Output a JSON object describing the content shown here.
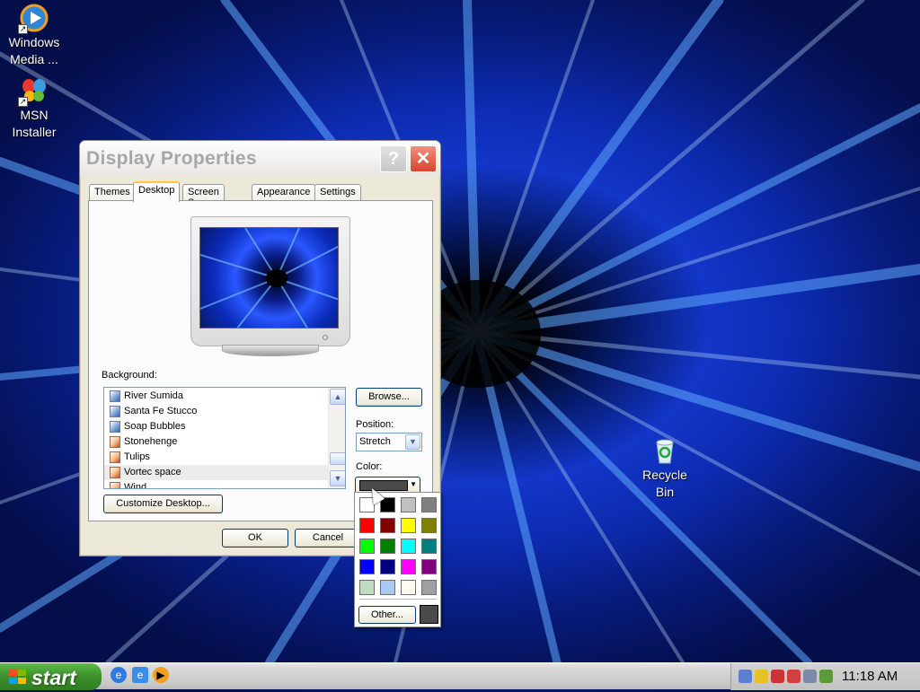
{
  "desktop": {
    "icons": [
      {
        "label_line1": "Windows",
        "label_line2": "Media ..."
      },
      {
        "label_line1": "MSN",
        "label_line2": "Installer"
      },
      {
        "label_line1": "Recycle",
        "label_line2": "Bin"
      }
    ]
  },
  "window": {
    "title": "Display Properties",
    "help_glyph": "?",
    "close_glyph": "✕",
    "tabs": [
      "Themes",
      "Desktop",
      "Screen Saver",
      "Appearance",
      "Settings"
    ],
    "active_tab": "Desktop",
    "background_label": "Background:",
    "background_items": [
      {
        "label": "River Sumida",
        "type": "image"
      },
      {
        "label": "Santa Fe Stucco",
        "type": "image"
      },
      {
        "label": "Soap Bubbles",
        "type": "image"
      },
      {
        "label": "Stonehenge",
        "type": "html"
      },
      {
        "label": "Tulips",
        "type": "html"
      },
      {
        "label": "Vortec space",
        "type": "html",
        "selected": true
      },
      {
        "label": "Wind",
        "type": "html"
      }
    ],
    "browse_label": "Browse...",
    "position_label": "Position:",
    "position_value": "Stretch",
    "color_label": "Color:",
    "current_color": "#4a4a4a",
    "customize_label": "Customize Desktop...",
    "ok_label": "OK",
    "cancel_label": "Cancel"
  },
  "color_popup": {
    "swatches": [
      "#ffffff",
      "#000000",
      "#c0c0c0",
      "#808080",
      "#ff0000",
      "#800000",
      "#ffff00",
      "#808000",
      "#00ff00",
      "#008000",
      "#00ffff",
      "#008080",
      "#0000ff",
      "#000080",
      "#ff00ff",
      "#800080",
      "#c0dcc0",
      "#a6caf0",
      "#fffbf0",
      "#a0a0a4"
    ],
    "other_label": "Other...",
    "custom_color": "#4a4a4a"
  },
  "taskbar": {
    "start_label": "start",
    "clock": "11:18 AM"
  }
}
